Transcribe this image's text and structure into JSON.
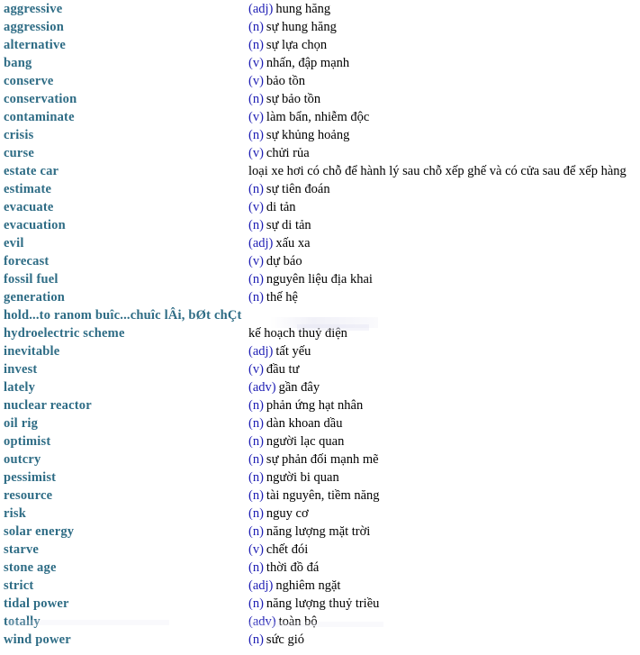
{
  "page": {
    "title": "Vocabulary list",
    "term_color": "#2e6c85",
    "pos_color": "#1d1db4",
    "gloss_color": "#000000",
    "background_color": "#ffffff"
  },
  "entries": [
    {
      "term": "aggressive",
      "pos": "(adj)",
      "gloss": "hung hăng"
    },
    {
      "term": "aggression",
      "pos": "(n)",
      "gloss": "sự hung hăng"
    },
    {
      "term": "alternative",
      "pos": "(n)",
      "gloss": "sự lựa chọn"
    },
    {
      "term": "bang",
      "pos": "(v)",
      "gloss": "nhấn, đập mạnh"
    },
    {
      "term": "conserve",
      "pos": "(v)",
      "gloss": "bảo tồn"
    },
    {
      "term": "conservation",
      "pos": "(n)",
      "gloss": "sự bảo tồn"
    },
    {
      "term": "contaminate",
      "pos": "(v)",
      "gloss": "làm bẩn, nhiễm độc"
    },
    {
      "term": "crisis",
      "pos": "(n)",
      "gloss": "sự khủng hoảng"
    },
    {
      "term": "curse",
      "pos": "(v)",
      "gloss": "chửi rủa"
    },
    {
      "term": "estate car",
      "pos": "",
      "gloss": "loại xe hơi có chỗ để hành lý sau chỗ xếp ghế và có cửa sau để xếp hàng"
    },
    {
      "term": "estimate",
      "pos": "(n)",
      "gloss": "sự tiên đoán"
    },
    {
      "term": "evacuate",
      "pos": "(v)",
      "gloss": "di tản"
    },
    {
      "term": "evacuation",
      "pos": "(n)",
      "gloss": "sự di tản"
    },
    {
      "term": "evil",
      "pos": "(adj)",
      "gloss": "xấu xa"
    },
    {
      "term": "forecast",
      "pos": "(v)",
      "gloss": "dự báo"
    },
    {
      "term": "fossil fuel",
      "pos": "(n)",
      "gloss": "nguyên liệu địa khai"
    },
    {
      "term": "generation",
      "pos": "(n)",
      "gloss": "thế hệ"
    },
    {
      "term": "hold...to ranom buîc...chuîc lÂi, bØt chÇt",
      "pos": "",
      "gloss": ""
    },
    {
      "term": "hydroelectric scheme",
      "pos": "",
      "gloss": "kế hoạch thuỷ điện"
    },
    {
      "term": "inevitable",
      "pos": "(adj)",
      "gloss": "tất yếu"
    },
    {
      "term": "invest",
      "pos": "(v)",
      "gloss": "đầu tư"
    },
    {
      "term": "lately",
      "pos": "(adv)",
      "gloss": "gần đây"
    },
    {
      "term": "nuclear reactor",
      "pos": "(n)",
      "gloss": "phản ứng hạt nhân"
    },
    {
      "term": "oil rig",
      "pos": "(n)",
      "gloss": "dàn khoan dầu"
    },
    {
      "term": "optimist",
      "pos": "(n)",
      "gloss": "người lạc quan"
    },
    {
      "term": "outcry",
      "pos": "(n)",
      "gloss": "sự phản đối mạnh mẽ"
    },
    {
      "term": "pessimist",
      "pos": "(n)",
      "gloss": "người bi quan"
    },
    {
      "term": "resource",
      "pos": "(n)",
      "gloss": "tài nguyên, tiềm năng"
    },
    {
      "term": "risk",
      "pos": "(n)",
      "gloss": "nguy cơ"
    },
    {
      "term": "solar energy",
      "pos": "(n)",
      "gloss": "năng lượng mặt trời"
    },
    {
      "term": "starve",
      "pos": "(v)",
      "gloss": "chết đói"
    },
    {
      "term": "stone age",
      "pos": "(n)",
      "gloss": "thời đồ đá"
    },
    {
      "term": "strict",
      "pos": "(adj)",
      "gloss": "nghiêm ngặt"
    },
    {
      "term": "tidal power",
      "pos": "(n)",
      "gloss": "năng lượng thuỷ triều"
    },
    {
      "term": "totally",
      "pos": "(adv)",
      "gloss": "toàn bộ"
    },
    {
      "term": "wind power",
      "pos": "(n)",
      "gloss": "sức gió"
    }
  ]
}
